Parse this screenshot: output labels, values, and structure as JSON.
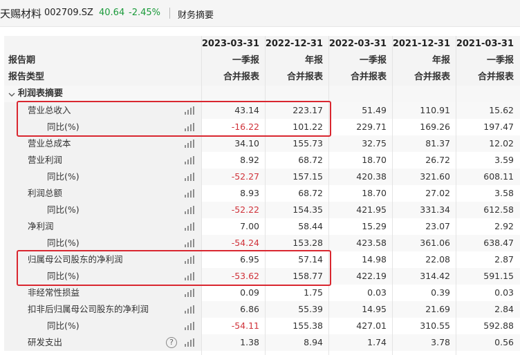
{
  "header": {
    "stock_name": "天赐材料",
    "stock_code": "002709.SZ",
    "price": "40.64",
    "change_pct": "-2.45%",
    "tab_label": "财务摘要"
  },
  "table": {
    "row_labels": {
      "period": "报告期",
      "report_type": "报告类型"
    },
    "section_label": "利润表摘要",
    "section_toggle_icon": "chevron-down-icon",
    "columns": [
      {
        "date": "2023-03-31",
        "period": "一季报",
        "type": "合并报表"
      },
      {
        "date": "2022-12-31",
        "period": "年报",
        "type": "合并报表"
      },
      {
        "date": "2022-03-31",
        "period": "一季报",
        "type": "合并报表"
      },
      {
        "date": "2021-12-31",
        "period": "年报",
        "type": "合并报表"
      },
      {
        "date": "2021-03-31",
        "period": "一季报",
        "type": "合并报表"
      }
    ],
    "rows": [
      {
        "label": "营业总收入",
        "sub": false,
        "values": [
          "43.14",
          "223.17",
          "51.49",
          "110.91",
          "15.62"
        ]
      },
      {
        "label": "同比(%)",
        "sub": true,
        "values": [
          "-16.22",
          "101.22",
          "229.71",
          "169.26",
          "197.47"
        ]
      },
      {
        "label": "营业总成本",
        "sub": false,
        "values": [
          "34.10",
          "155.73",
          "32.75",
          "81.37",
          "12.02"
        ]
      },
      {
        "label": "营业利润",
        "sub": false,
        "values": [
          "8.92",
          "68.72",
          "18.70",
          "26.72",
          "3.59"
        ]
      },
      {
        "label": "同比(%)",
        "sub": true,
        "values": [
          "-52.27",
          "157.15",
          "420.38",
          "321.60",
          "608.11"
        ]
      },
      {
        "label": "利润总额",
        "sub": false,
        "values": [
          "8.93",
          "68.72",
          "18.70",
          "27.02",
          "3.58"
        ]
      },
      {
        "label": "同比(%)",
        "sub": true,
        "values": [
          "-52.22",
          "154.35",
          "421.95",
          "331.34",
          "612.58"
        ]
      },
      {
        "label": "净利润",
        "sub": false,
        "values": [
          "7.00",
          "58.44",
          "15.29",
          "23.07",
          "2.92"
        ]
      },
      {
        "label": "同比(%)",
        "sub": true,
        "values": [
          "-54.24",
          "153.28",
          "423.58",
          "361.06",
          "638.47"
        ]
      },
      {
        "label": "归属母公司股东的净利润",
        "sub": false,
        "values": [
          "6.95",
          "57.14",
          "14.98",
          "22.08",
          "2.87"
        ]
      },
      {
        "label": "同比(%)",
        "sub": true,
        "values": [
          "-53.62",
          "158.77",
          "422.19",
          "314.42",
          "591.15"
        ]
      },
      {
        "label": "非经常性损益",
        "sub": false,
        "values": [
          "0.09",
          "1.75",
          "0.03",
          "0.39",
          "0.03"
        ]
      },
      {
        "label": "扣非后归属母公司股东的净利润",
        "sub": false,
        "values": [
          "6.86",
          "55.39",
          "14.95",
          "21.69",
          "2.84"
        ]
      },
      {
        "label": "同比(%)",
        "sub": true,
        "values": [
          "-54.11",
          "155.38",
          "427.01",
          "310.55",
          "592.88"
        ]
      },
      {
        "label": "研发支出",
        "sub": false,
        "help": true,
        "values": [
          "1.38",
          "8.94",
          "1.74",
          "3.78",
          "0.56"
        ]
      }
    ],
    "row_icon": "bar-chart-icon",
    "help_icon": "question-circle-icon",
    "help_symbol": "?",
    "highlight_color": "#d9262f",
    "positive_color": "#1a9a3a",
    "negative_color": "#d0323a"
  }
}
